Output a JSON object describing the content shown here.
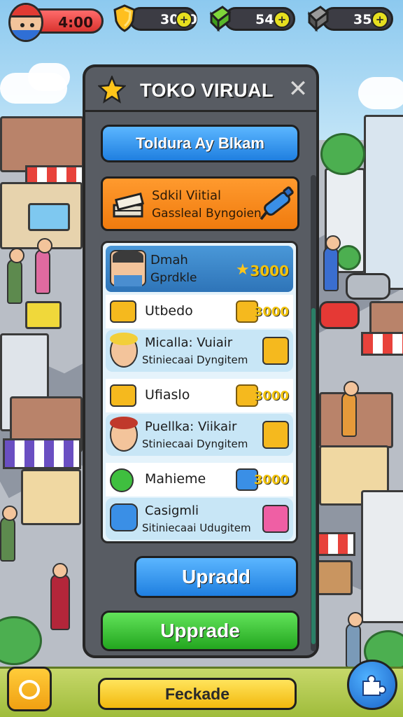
{
  "hud": {
    "timer": "4:00",
    "shield_count": "3020",
    "green_count": "540",
    "stone_count": "350",
    "plus_label": "+"
  },
  "panel": {
    "title": "TOKO VIRUAL",
    "close_label": "✕",
    "top_button": "Toldura Ay Blkam",
    "featured": {
      "line1": "Sdkil Viitial",
      "line2": "Gassleal Byngoien"
    },
    "selected_item": {
      "line1": "Dmah",
      "line2": "Gprdkle",
      "price": "3000"
    },
    "items": [
      {
        "name": "Utbedo",
        "price": "3000"
      },
      {
        "sub_title": "Micalla: Vuiair",
        "sub_desc": "Stiniecaai Dyngitem"
      },
      {
        "name": "Ufiaslo",
        "price": "3000"
      },
      {
        "sub_title": "Puellka: Viikair",
        "sub_desc": "Stiniecaai Dyngitem"
      },
      {
        "name": "Mahieme",
        "price": "3000"
      },
      {
        "sub_title": "Casigmli",
        "sub_desc": "Sitiniecaai Udugitem"
      }
    ],
    "upgrade_blue": "Upradd",
    "upgrade_green": "Upprade"
  },
  "bottom": {
    "center_button": "Feckade"
  },
  "colors": {
    "panel": "#585c63",
    "price_gold": "#f2c30c",
    "blue_button": "#1f7fe0",
    "green_button": "#23a61f",
    "orange_card": "#f07b0e"
  }
}
